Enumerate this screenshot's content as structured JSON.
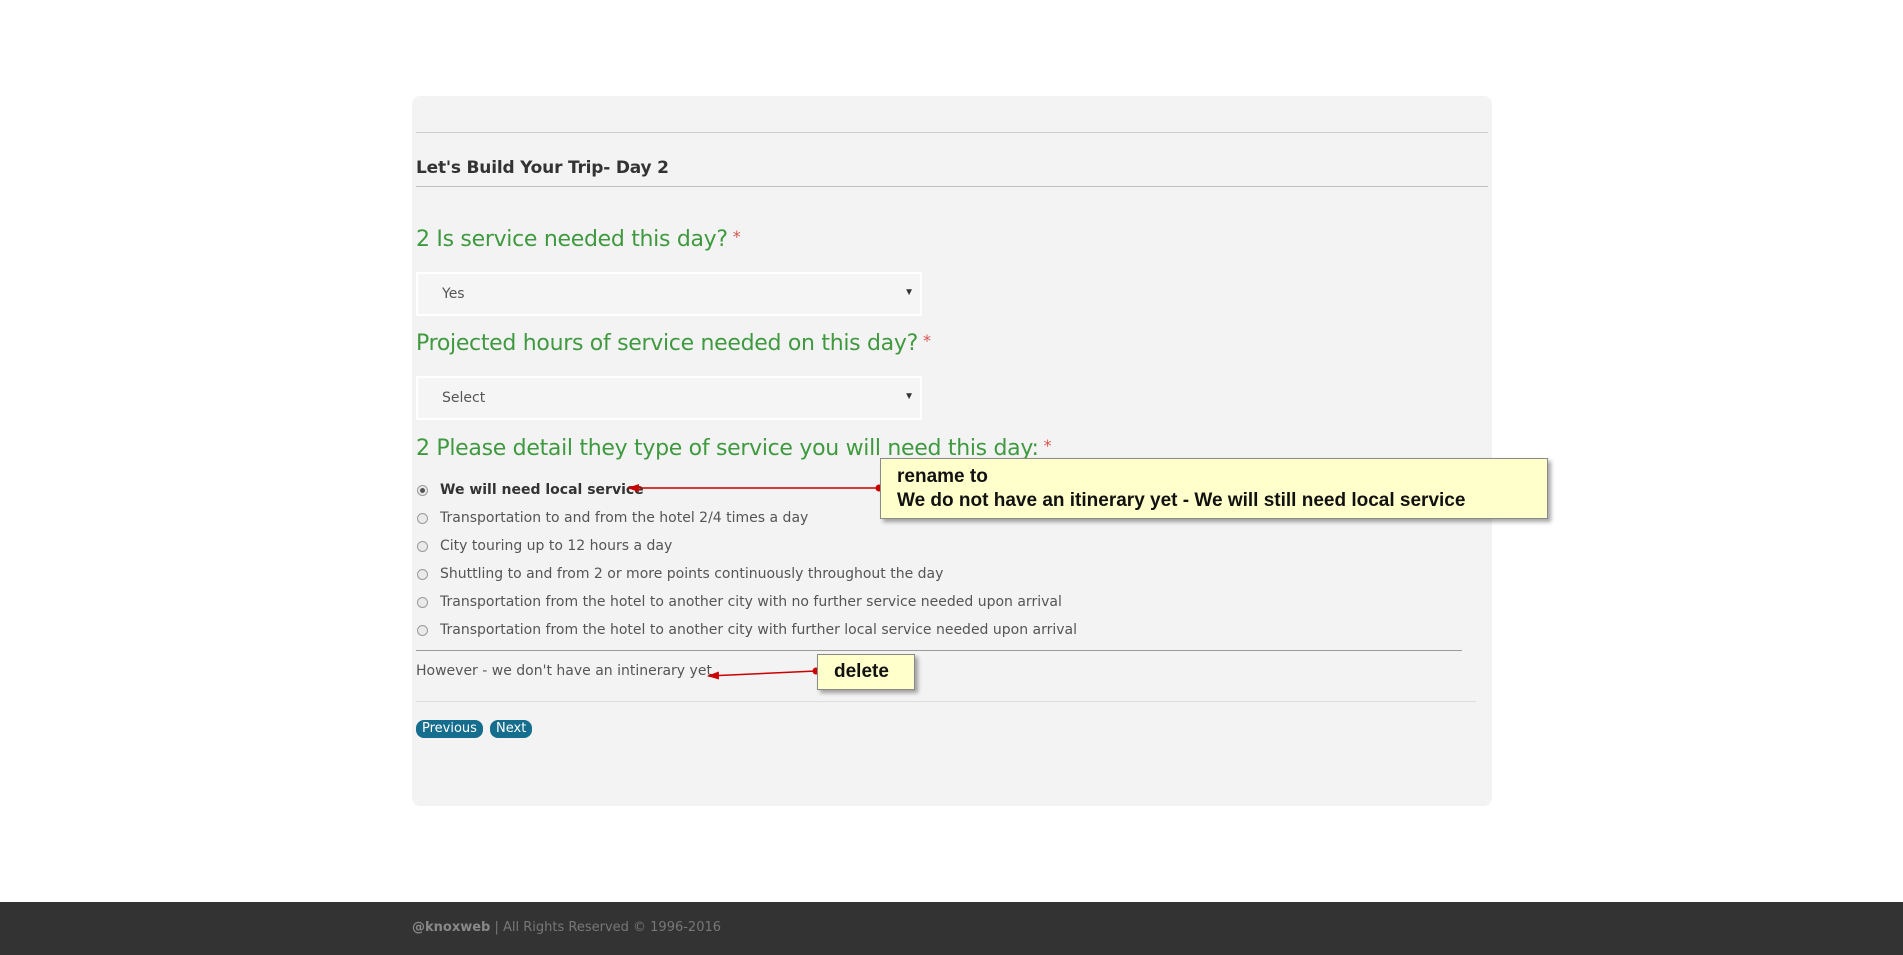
{
  "form": {
    "section_title": "Let's Build Your Trip- Day 2",
    "q_service": {
      "label": "2 Is service needed this day?",
      "required_mark": "*",
      "selected": "Yes"
    },
    "q_hours": {
      "label": "Projected hours of service needed on this day?",
      "required_mark": "*",
      "selected": "Select"
    },
    "q_type": {
      "label": "2 Please detail they type of service you will need this day:",
      "required_mark": "*",
      "options": [
        {
          "label": "We will need local service",
          "checked": true
        },
        {
          "label": "Transportation to and from the hotel 2/4 times a day",
          "checked": false
        },
        {
          "label": "City touring up to 12 hours a day",
          "checked": false
        },
        {
          "label": "Shuttling to and from 2 or more points continuously throughout the day",
          "checked": false
        },
        {
          "label": "Transportation from the hotel to another city with no further service needed upon arrival",
          "checked": false
        },
        {
          "label": "Transportation from the hotel to another city with further local service needed upon arrival",
          "checked": false
        }
      ]
    },
    "note_text": "However - we don't have an intinerary yet",
    "buttons": {
      "previous": "Previous",
      "next": "Next"
    }
  },
  "annotations": {
    "rename": {
      "line1": "rename to",
      "line2": "We do not have an itinerary yet - We will still need local service"
    },
    "delete": {
      "text": "delete"
    },
    "arrow_color": "#cc0000"
  },
  "footer": {
    "brand": "@knoxweb",
    "rights": " | All Rights Reserved © 1996-2016"
  },
  "colors": {
    "question_green": "#3f9a3f",
    "button_blue": "#166e8e",
    "callout_yellow": "#ffffcc",
    "footer_bg": "#333333"
  }
}
